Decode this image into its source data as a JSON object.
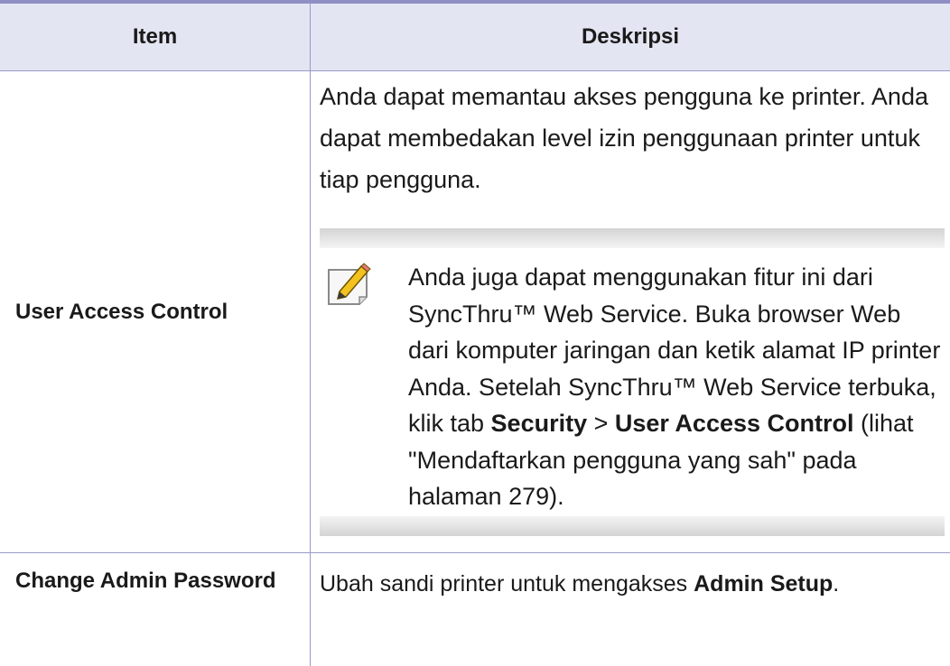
{
  "table": {
    "headers": {
      "item": "Item",
      "description": "Deskripsi"
    },
    "rows": [
      {
        "item": "User Access Control",
        "description": "Anda dapat memantau akses pengguna ke printer. Anda dapat membedakan level izin penggunaan printer untuk tiap pengguna.",
        "note": {
          "icon": "pencil-note-icon",
          "text_part1": "Anda juga dapat menggunakan fitur ini dari SyncThru™ Web Service. Buka browser Web dari komputer jaringan dan ketik alamat IP printer Anda. Setelah SyncThru™ Web Service terbuka, klik tab ",
          "bold1": "Security",
          "text_part2": " > ",
          "bold2": "User Access Control",
          "text_part3": " (lihat \"Mendaftarkan pengguna yang sah\" pada halaman 279)."
        }
      },
      {
        "item": "Change Admin Password",
        "description_part1": "Ubah sandi printer untuk mengakses ",
        "description_bold": "Admin Setup",
        "description_part2": "."
      }
    ]
  },
  "colors": {
    "header_bg": "#e4e5f3",
    "rule": "#8f8fc4",
    "grid": "#9a9ac8"
  }
}
